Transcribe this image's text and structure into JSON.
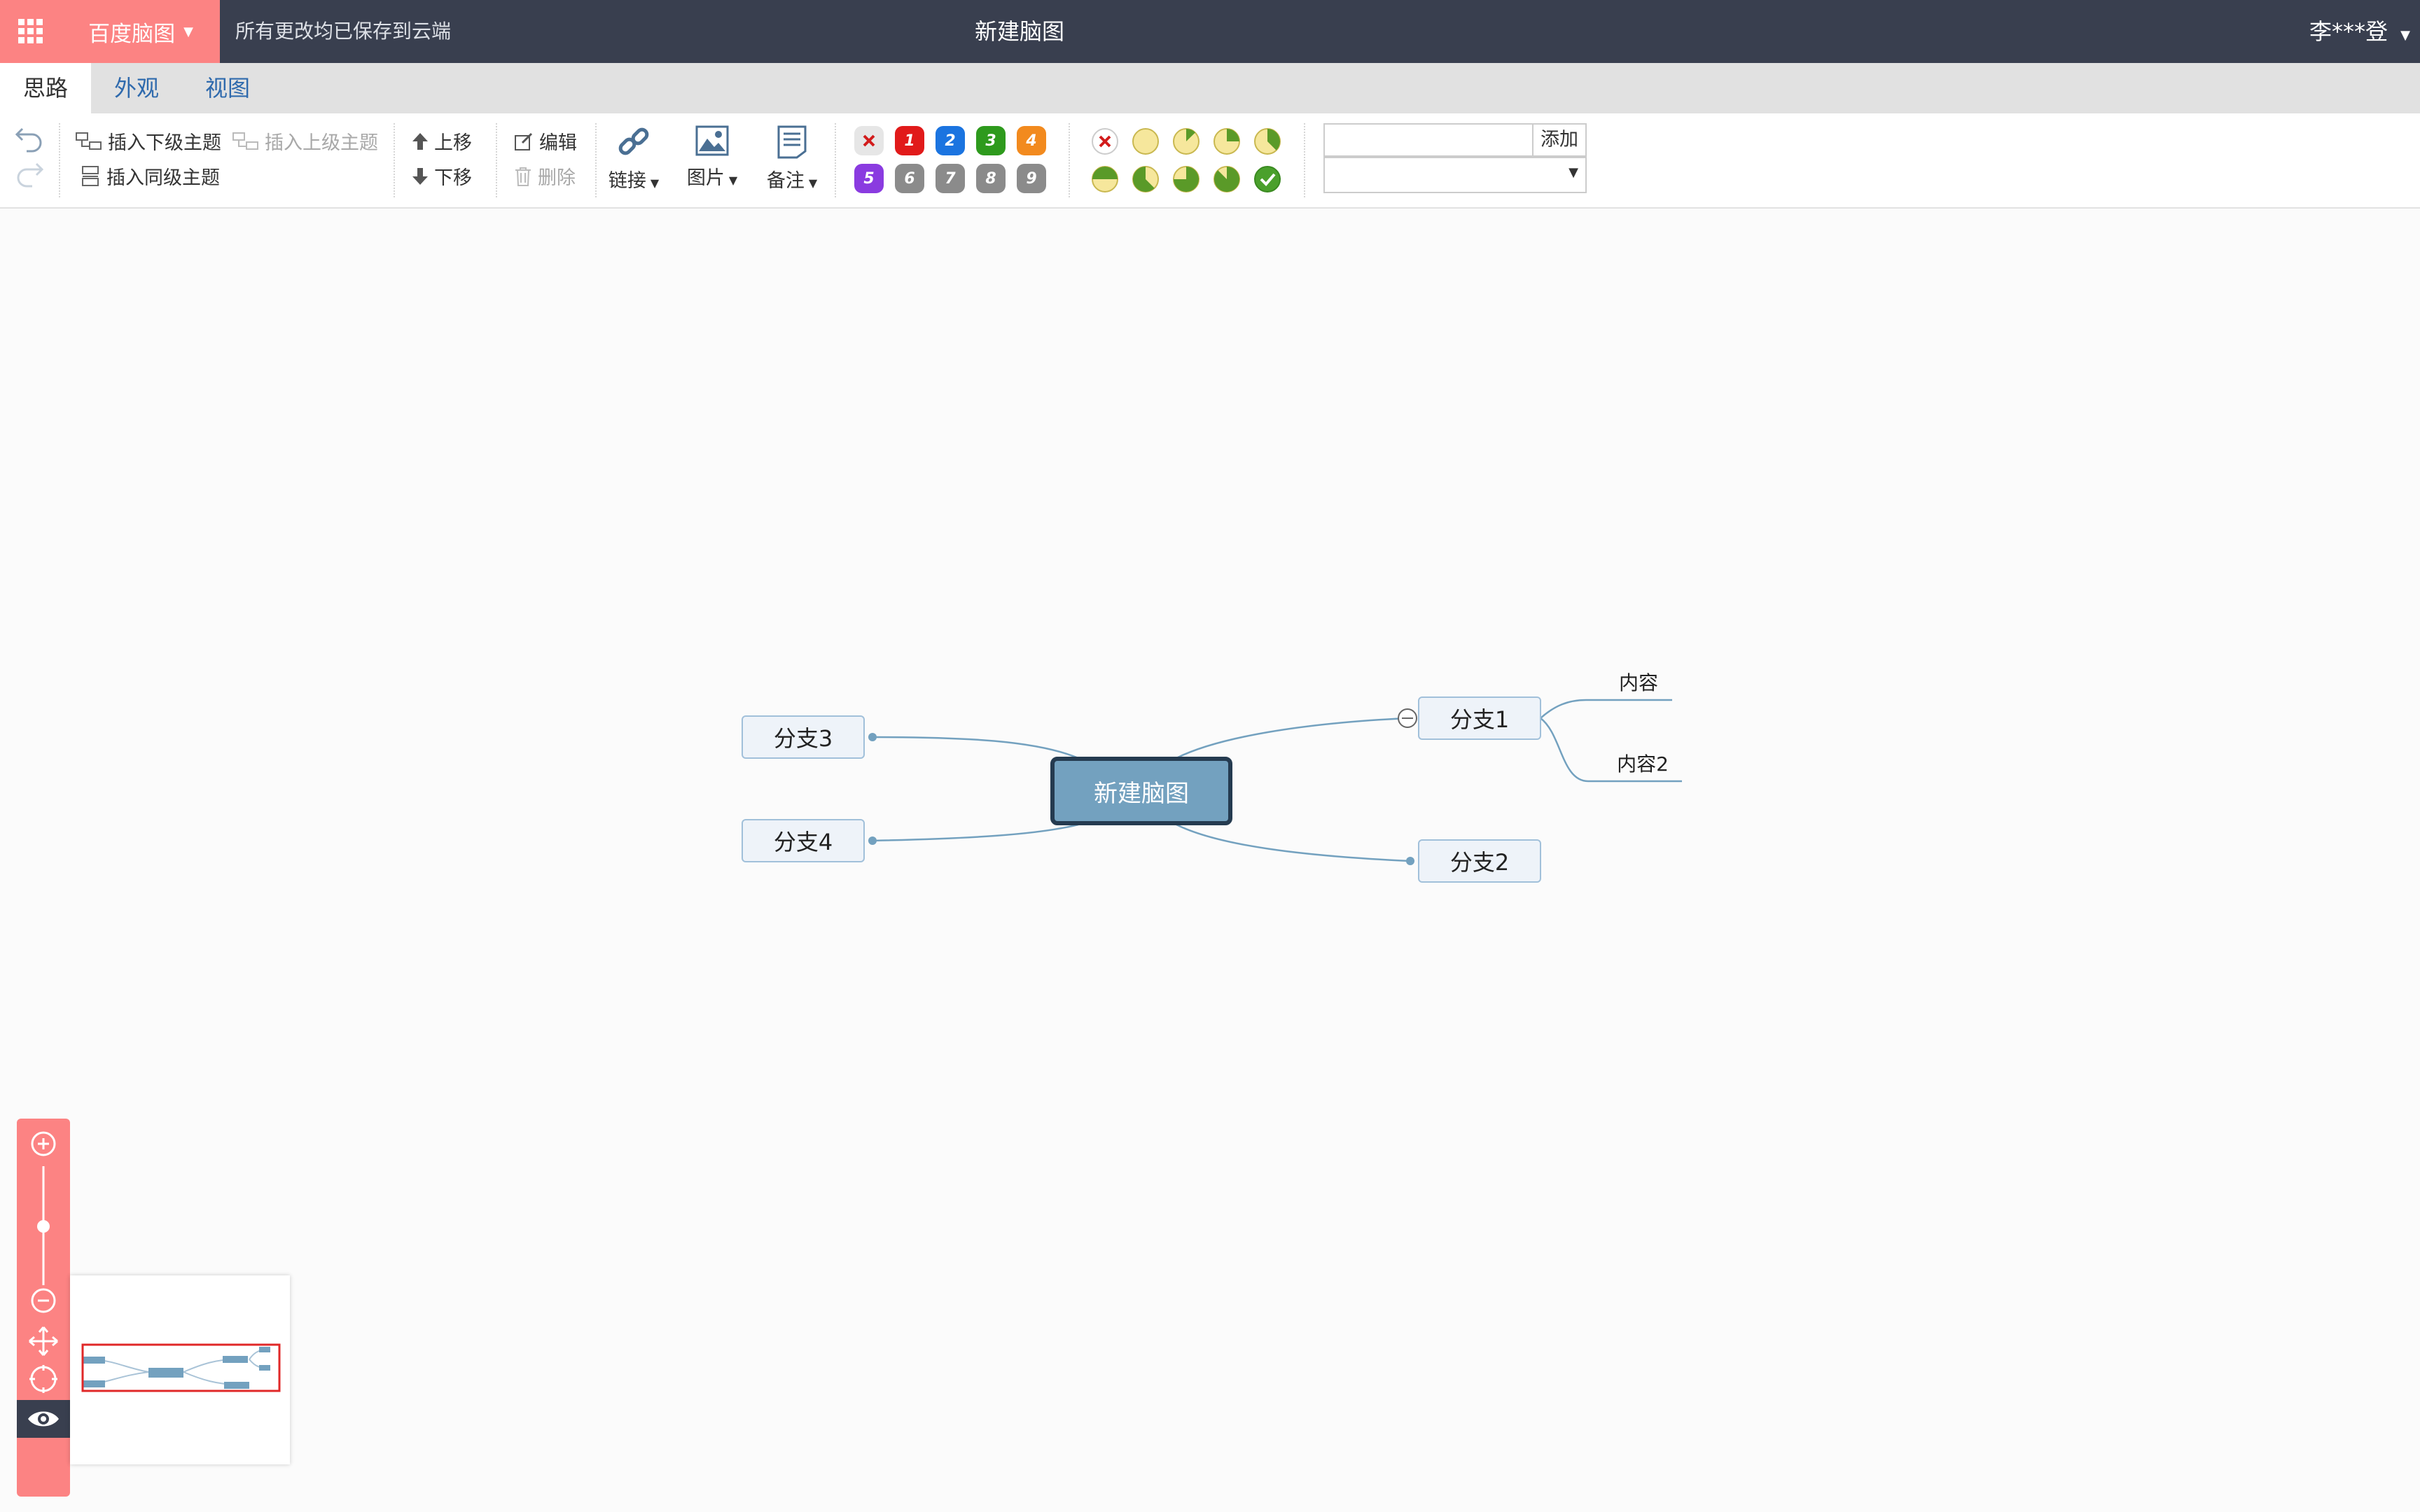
{
  "header": {
    "brand": "百度脑图",
    "save_status": "所有更改均已保存到云端",
    "doc_title": "新建脑图",
    "user": "李***登"
  },
  "tabs": [
    {
      "label": "思路",
      "active": true
    },
    {
      "label": "外观",
      "active": false
    },
    {
      "label": "视图",
      "active": false
    }
  ],
  "toolbar": {
    "insert_child": "插入下级主题",
    "insert_parent": "插入上级主题",
    "insert_sibling": "插入同级主题",
    "move_up": "上移",
    "move_down": "下移",
    "edit": "编辑",
    "delete": "删除",
    "link": "链接",
    "image": "图片",
    "note": "备注",
    "priorities": [
      "1",
      "2",
      "3",
      "4",
      "5",
      "6",
      "7",
      "8",
      "9"
    ],
    "priority_colors": [
      "#e11a1a",
      "#1b74e0",
      "#2e9a1d",
      "#f28a1e",
      "#8a3be0",
      "#8b8b8b",
      "#8b8b8b",
      "#8b8b8b",
      "#8b8b8b"
    ],
    "resource_add": "添加"
  },
  "mindmap": {
    "root": "新建脑图",
    "branch1": "分支1",
    "branch2": "分支2",
    "branch3": "分支3",
    "branch4": "分支4",
    "sub1": "内容",
    "sub2": "内容2",
    "line_color": "#73a1bf"
  },
  "colors": {
    "topbar": "#393f4f",
    "accent": "#fc8383",
    "tab_text": "#2f6aad"
  }
}
